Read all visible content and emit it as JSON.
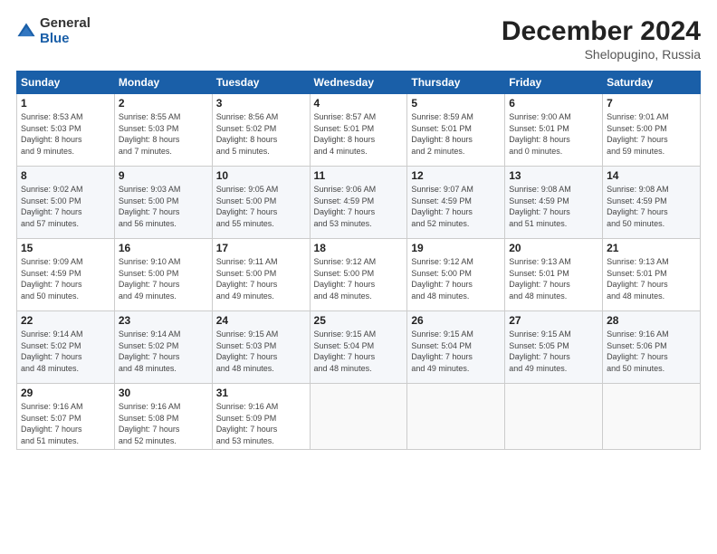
{
  "logo": {
    "general": "General",
    "blue": "Blue"
  },
  "header": {
    "month": "December 2024",
    "location": "Shelopugino, Russia"
  },
  "weekdays": [
    "Sunday",
    "Monday",
    "Tuesday",
    "Wednesday",
    "Thursday",
    "Friday",
    "Saturday"
  ],
  "weeks": [
    [
      {
        "day": "1",
        "info": "Sunrise: 8:53 AM\nSunset: 5:03 PM\nDaylight: 8 hours\nand 9 minutes."
      },
      {
        "day": "2",
        "info": "Sunrise: 8:55 AM\nSunset: 5:03 PM\nDaylight: 8 hours\nand 7 minutes."
      },
      {
        "day": "3",
        "info": "Sunrise: 8:56 AM\nSunset: 5:02 PM\nDaylight: 8 hours\nand 5 minutes."
      },
      {
        "day": "4",
        "info": "Sunrise: 8:57 AM\nSunset: 5:01 PM\nDaylight: 8 hours\nand 4 minutes."
      },
      {
        "day": "5",
        "info": "Sunrise: 8:59 AM\nSunset: 5:01 PM\nDaylight: 8 hours\nand 2 minutes."
      },
      {
        "day": "6",
        "info": "Sunrise: 9:00 AM\nSunset: 5:01 PM\nDaylight: 8 hours\nand 0 minutes."
      },
      {
        "day": "7",
        "info": "Sunrise: 9:01 AM\nSunset: 5:00 PM\nDaylight: 7 hours\nand 59 minutes."
      }
    ],
    [
      {
        "day": "8",
        "info": "Sunrise: 9:02 AM\nSunset: 5:00 PM\nDaylight: 7 hours\nand 57 minutes."
      },
      {
        "day": "9",
        "info": "Sunrise: 9:03 AM\nSunset: 5:00 PM\nDaylight: 7 hours\nand 56 minutes."
      },
      {
        "day": "10",
        "info": "Sunrise: 9:05 AM\nSunset: 5:00 PM\nDaylight: 7 hours\nand 55 minutes."
      },
      {
        "day": "11",
        "info": "Sunrise: 9:06 AM\nSunset: 4:59 PM\nDaylight: 7 hours\nand 53 minutes."
      },
      {
        "day": "12",
        "info": "Sunrise: 9:07 AM\nSunset: 4:59 PM\nDaylight: 7 hours\nand 52 minutes."
      },
      {
        "day": "13",
        "info": "Sunrise: 9:08 AM\nSunset: 4:59 PM\nDaylight: 7 hours\nand 51 minutes."
      },
      {
        "day": "14",
        "info": "Sunrise: 9:08 AM\nSunset: 4:59 PM\nDaylight: 7 hours\nand 50 minutes."
      }
    ],
    [
      {
        "day": "15",
        "info": "Sunrise: 9:09 AM\nSunset: 4:59 PM\nDaylight: 7 hours\nand 50 minutes."
      },
      {
        "day": "16",
        "info": "Sunrise: 9:10 AM\nSunset: 5:00 PM\nDaylight: 7 hours\nand 49 minutes."
      },
      {
        "day": "17",
        "info": "Sunrise: 9:11 AM\nSunset: 5:00 PM\nDaylight: 7 hours\nand 49 minutes."
      },
      {
        "day": "18",
        "info": "Sunrise: 9:12 AM\nSunset: 5:00 PM\nDaylight: 7 hours\nand 48 minutes."
      },
      {
        "day": "19",
        "info": "Sunrise: 9:12 AM\nSunset: 5:00 PM\nDaylight: 7 hours\nand 48 minutes."
      },
      {
        "day": "20",
        "info": "Sunrise: 9:13 AM\nSunset: 5:01 PM\nDaylight: 7 hours\nand 48 minutes."
      },
      {
        "day": "21",
        "info": "Sunrise: 9:13 AM\nSunset: 5:01 PM\nDaylight: 7 hours\nand 48 minutes."
      }
    ],
    [
      {
        "day": "22",
        "info": "Sunrise: 9:14 AM\nSunset: 5:02 PM\nDaylight: 7 hours\nand 48 minutes."
      },
      {
        "day": "23",
        "info": "Sunrise: 9:14 AM\nSunset: 5:02 PM\nDaylight: 7 hours\nand 48 minutes."
      },
      {
        "day": "24",
        "info": "Sunrise: 9:15 AM\nSunset: 5:03 PM\nDaylight: 7 hours\nand 48 minutes."
      },
      {
        "day": "25",
        "info": "Sunrise: 9:15 AM\nSunset: 5:04 PM\nDaylight: 7 hours\nand 48 minutes."
      },
      {
        "day": "26",
        "info": "Sunrise: 9:15 AM\nSunset: 5:04 PM\nDaylight: 7 hours\nand 49 minutes."
      },
      {
        "day": "27",
        "info": "Sunrise: 9:15 AM\nSunset: 5:05 PM\nDaylight: 7 hours\nand 49 minutes."
      },
      {
        "day": "28",
        "info": "Sunrise: 9:16 AM\nSunset: 5:06 PM\nDaylight: 7 hours\nand 50 minutes."
      }
    ],
    [
      {
        "day": "29",
        "info": "Sunrise: 9:16 AM\nSunset: 5:07 PM\nDaylight: 7 hours\nand 51 minutes."
      },
      {
        "day": "30",
        "info": "Sunrise: 9:16 AM\nSunset: 5:08 PM\nDaylight: 7 hours\nand 52 minutes."
      },
      {
        "day": "31",
        "info": "Sunrise: 9:16 AM\nSunset: 5:09 PM\nDaylight: 7 hours\nand 53 minutes."
      },
      null,
      null,
      null,
      null
    ]
  ]
}
